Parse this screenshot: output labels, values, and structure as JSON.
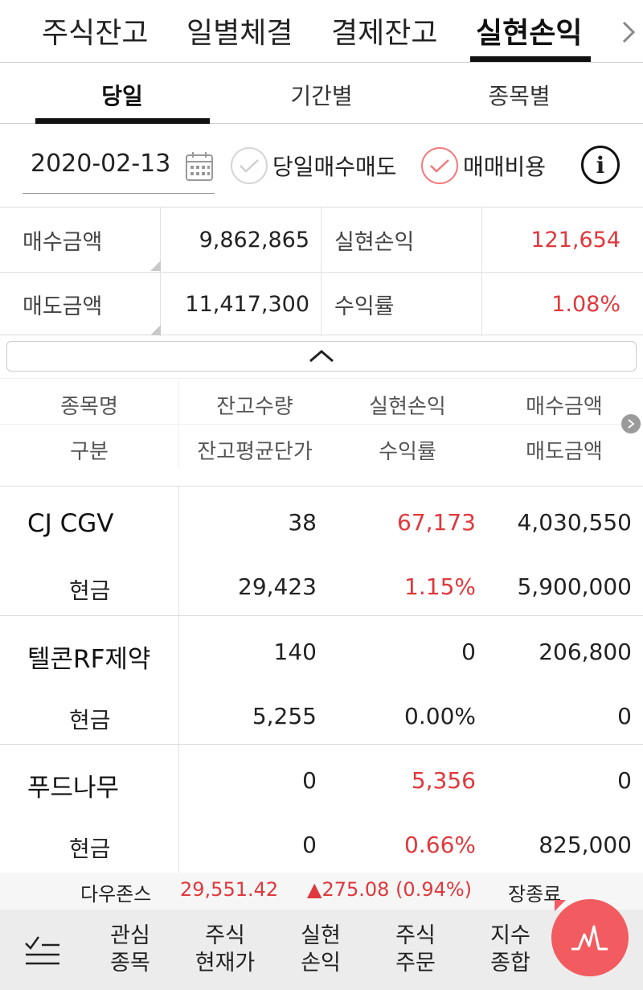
{
  "top_tabs": [
    "주식잔고",
    "일별체결",
    "결제잔고",
    "실현손익"
  ],
  "sub_tabs": [
    "당일",
    "기간별",
    "종목별"
  ],
  "filter": {
    "date": "2020-02-13",
    "check_same_day": "당일매수매도",
    "check_fee": "매매비용"
  },
  "summary": {
    "buy_label": "매수금액",
    "buy_value": "9,862,865",
    "realized_label": "실현손익",
    "realized_value": "121,654",
    "sell_label": "매도금액",
    "sell_value": "11,417,300",
    "rate_label": "수익률",
    "rate_value": "1.08%"
  },
  "list_header": {
    "row1": [
      "종목명",
      "잔고수량",
      "실현손익",
      "매수금액"
    ],
    "row2": [
      "구분",
      "잔고평균단가",
      "수익률",
      "매도금액"
    ]
  },
  "rows": [
    {
      "name": "CJ CGV",
      "qty": "38",
      "pnl": "67,173",
      "buy": "4,030,550",
      "type": "현금",
      "avg": "29,423",
      "rate": "1.15%",
      "sell": "5,900,000"
    },
    {
      "name": "텔콘RF제약",
      "qty": "140",
      "pnl": "0",
      "buy": "206,800",
      "type": "현금",
      "avg": "5,255",
      "rate": "0.00%",
      "sell": "0"
    },
    {
      "name": "푸드나무",
      "qty": "0",
      "pnl": "5,356",
      "buy": "0",
      "type": "현금",
      "avg": "0",
      "rate": "0.66%",
      "sell": "825,000"
    }
  ],
  "ticker": {
    "index_name": "다우존스",
    "index_value": "29,551.42",
    "change": "▲275.08 (0.94%)",
    "status": "장종료"
  },
  "bottom_nav": [
    {
      "line1": "관심",
      "line2": "종목"
    },
    {
      "line1": "주식",
      "line2": "현재가"
    },
    {
      "line1": "실현",
      "line2": "손익"
    },
    {
      "line1": "주식",
      "line2": "주문"
    },
    {
      "line1": "지수",
      "line2": "종합"
    }
  ],
  "colors": {
    "accent_red": "#e0383c",
    "fab": "#f25b5f"
  }
}
